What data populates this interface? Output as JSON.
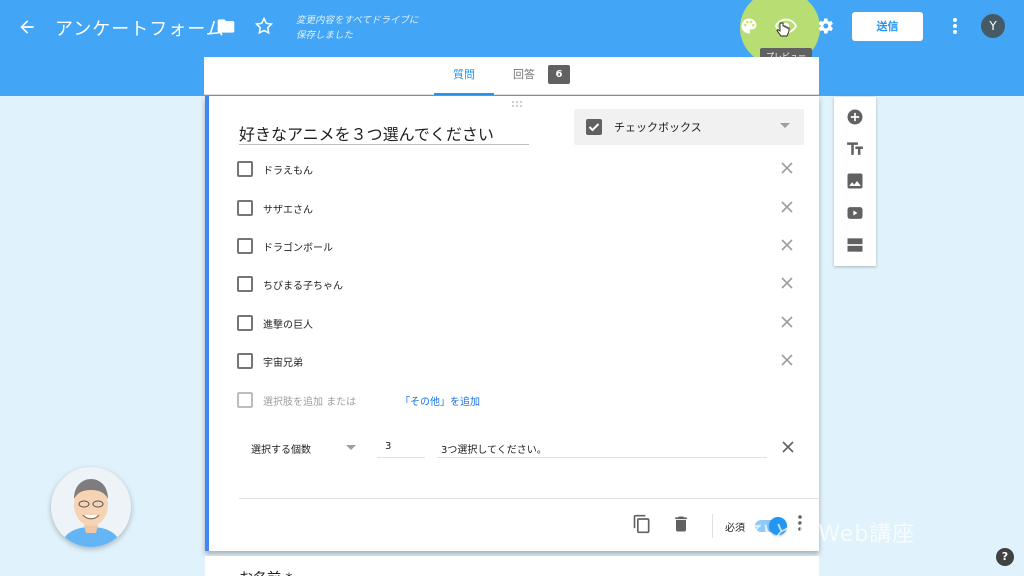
{
  "header": {
    "title": "アンケートフォーム",
    "saved_line1": "変更内容をすべてドライブに",
    "saved_line2": "保存しました",
    "send_label": "送信",
    "avatar_letter": "Y",
    "preview_tooltip": "プレビュー",
    "icons": [
      "back-arrow-icon",
      "folder-icon",
      "star-icon",
      "palette-icon",
      "eye-icon",
      "gear-icon",
      "more-vert-icon"
    ]
  },
  "tabs": {
    "questions": "質問",
    "responses": "回答",
    "responses_count": "6"
  },
  "question": {
    "title": "好きなアニメを３つ選んでください",
    "type_label": "チェックボックス",
    "options": [
      "ドラえもん",
      "サザエさん",
      "ドラゴンボール",
      "ちびまる子ちゃん",
      "進撃の巨人",
      "宇宙兄弟"
    ],
    "add_option": "選択肢を追加",
    "or": "または",
    "add_other": "「その他」を追加",
    "validation": {
      "select_label": "選択する個数",
      "count": "3",
      "message": "3つ選択してください。"
    },
    "required_label": "必須",
    "required_on": true
  },
  "next_question_title": "お名前 *",
  "sidebar_icons": [
    "add-question-icon",
    "title-text-icon",
    "image-icon",
    "video-icon",
    "section-icon"
  ],
  "watermark": "ひとりWeb講座",
  "colors": {
    "header": "#42a5f5",
    "background": "#e0f2fb",
    "accent": "#2196f3",
    "highlight": "#cde65a"
  }
}
